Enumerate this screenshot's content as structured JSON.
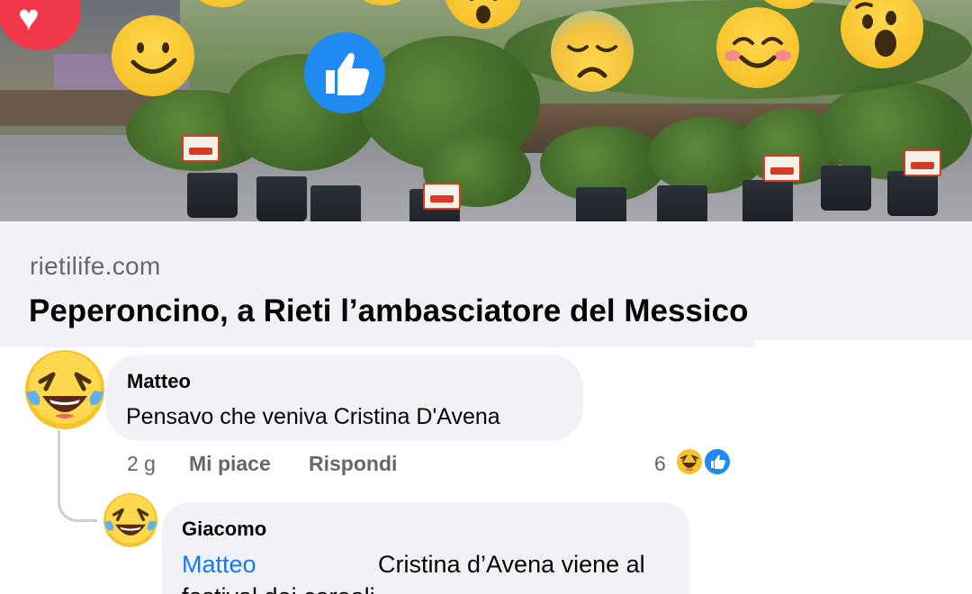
{
  "link_preview": {
    "domain": "rietilife.com",
    "title": "Peperoncino, a Rieti l’ambasciatore del Messico",
    "reaction_overlays": [
      "heart-icon",
      "smile-emoji-icon",
      "like-icon",
      "wow-emoji-icon",
      "sad-emoji-icon",
      "blush-emoji-icon",
      "wow-emoji-icon"
    ]
  },
  "comments": [
    {
      "author": "Matteo",
      "text": "Pensavo che veniva Cristina D'Avena",
      "avatar_icon": "laughing-tears-emoji-icon",
      "time": "2 g",
      "like_label": "Mi piace",
      "reply_label": "Rispondi",
      "reaction_count": "6",
      "reaction_icons": [
        "haha-icon",
        "like-icon"
      ]
    },
    {
      "author": "Giacomo",
      "mention": "Matteo",
      "text_line1": "Cristina d’Avena viene al",
      "text_line2": "festival dei cereali",
      "avatar_icon": "laughing-tears-emoji-icon"
    }
  ],
  "colors": {
    "bubble": "#f0f2f5",
    "mention": "#1877f2",
    "secondary_text": "#65676b",
    "like_blue": "#1f8bf0",
    "love_red": "#f0384a"
  }
}
